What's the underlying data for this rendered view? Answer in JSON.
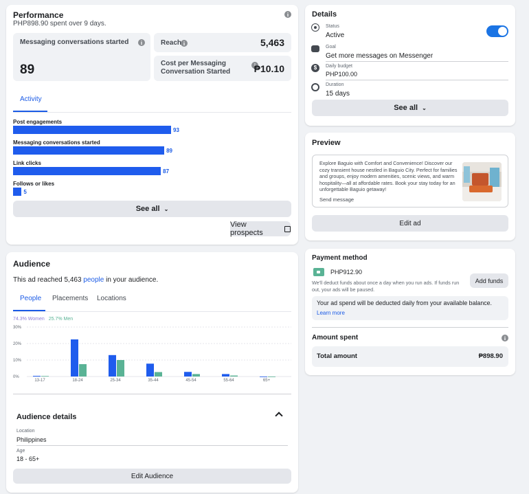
{
  "performance": {
    "title": "Performance",
    "subtitle": "PHP898.90 spent over 9 days.",
    "messaging_label": "Messaging conversations started",
    "messaging_value": "89",
    "reach_label": "Reach",
    "reach_value": "5,463",
    "cost_label": "Cost per Messaging Conversation Started",
    "cost_value": "₱10.10",
    "activity_tab": "Activity",
    "activity": [
      {
        "label": "Post engagements",
        "value": 93
      },
      {
        "label": "Messaging conversations started",
        "value": 89
      },
      {
        "label": "Link clicks",
        "value": 87
      },
      {
        "label": "Follows or likes",
        "value": 5
      }
    ],
    "see_all": "See all",
    "view_prospects": "View prospects"
  },
  "audience": {
    "title": "Audience",
    "reached_prefix": "This ad reached 5,463 ",
    "reached_link": "people",
    "reached_suffix": " in your audience.",
    "tabs": [
      "People",
      "Placements",
      "Locations"
    ],
    "women_legend": "74.3% Women",
    "men_legend": "25.7% Men",
    "details_title": "Audience details",
    "location_label": "Location",
    "location_value": "Philippines",
    "age_label": "Age",
    "age_value": "18 - 65+",
    "edit_button": "Edit Audience"
  },
  "chart_data": {
    "type": "bar",
    "categories": [
      "13-17",
      "18-24",
      "25-34",
      "35-44",
      "45-54",
      "55-64",
      "65+"
    ],
    "series": [
      {
        "name": "Women",
        "values": [
          0.4,
          22.5,
          13,
          7.8,
          2.8,
          1.5,
          0
        ],
        "color": "#1f5ced"
      },
      {
        "name": "Men",
        "values": [
          0.3,
          7.5,
          10,
          2.7,
          1.5,
          0.6,
          0
        ],
        "color": "#5ab395"
      }
    ],
    "yticks": [
      "0%",
      "10%",
      "20%",
      "30%"
    ],
    "ylim": [
      0,
      30
    ]
  },
  "details": {
    "title": "Details",
    "status_label": "Status",
    "status_value": "Active",
    "goal_label": "Goal",
    "goal_value": "Get more messages on Messenger",
    "budget_label": "Daily budget",
    "budget_value": "PHP100.00",
    "duration_label": "Duration",
    "duration_value": "15 days",
    "see_all": "See all"
  },
  "preview": {
    "title": "Preview",
    "text": "Explore Baguio with Comfort and Convenience! Discover our cozy transient house nestled in Baguio City. Perfect for families and groups, enjoy modern amenities, scenic views, and warm hospitality—all at affordable rates. Book your stay today for an unforgettable Baguio getaway!",
    "send_message": "Send message",
    "edit_ad": "Edit ad"
  },
  "payment": {
    "title": "Payment method",
    "balance": "PHP912.90",
    "note": "We'll deduct funds about once a day when you run ads. If funds run out, your ads will be paused.",
    "add_funds": "Add funds",
    "daily_note": "Your ad spend will be deducted daily from your available balance.",
    "learn_more": "Learn more",
    "amount_spent_title": "Amount spent",
    "total_label": "Total amount",
    "total_value": "₱898.90"
  },
  "colors": {
    "accent": "#1b5be6",
    "bar": "#1f5ced",
    "men": "#5ab395",
    "toggle": "#1b74e4"
  }
}
